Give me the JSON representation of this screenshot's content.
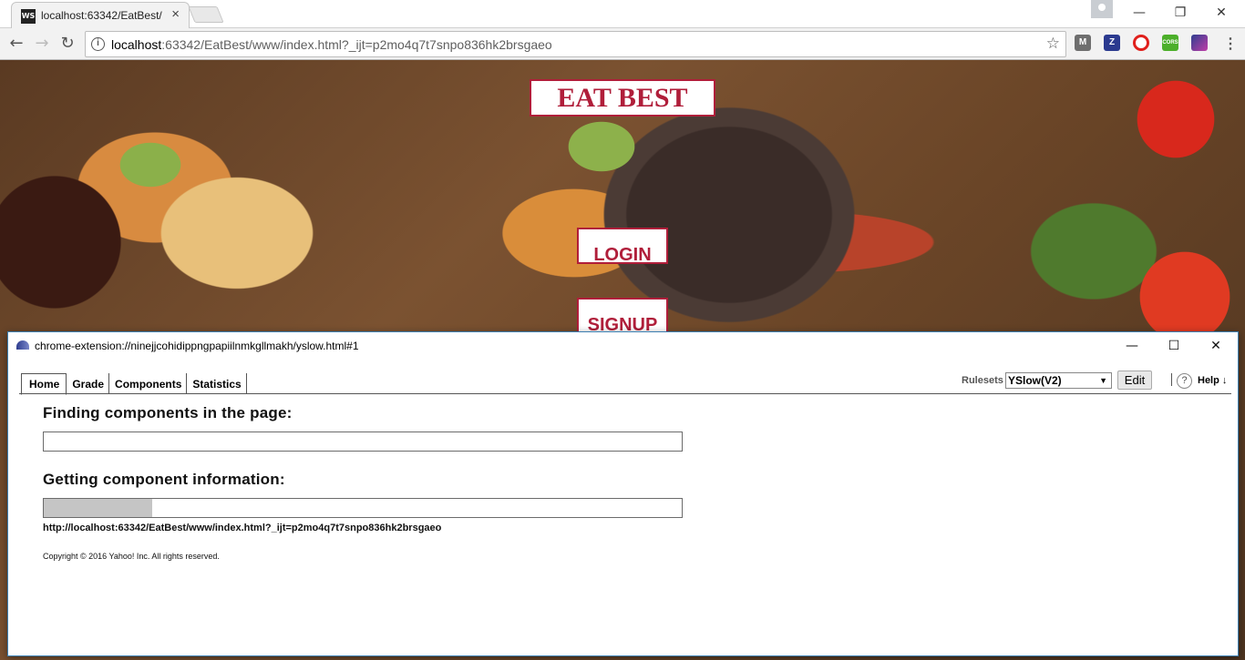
{
  "browser": {
    "tab_title": "localhost:63342/EatBest/",
    "tab_close": "×",
    "tab_favicon": "WS",
    "url_host": "localhost",
    "url_rest": ":63342/EatBest/www/index.html?_ijt=p2mo4q7t7snpo836hk2brsgaeo",
    "window_controls": {
      "minimize": "—",
      "restore": "❐",
      "close": "✕"
    },
    "nav": {
      "back": "←",
      "forward": "→",
      "reload": "↻"
    },
    "star": "☆",
    "extensions": [
      {
        "name": "m-extension-icon",
        "label": "M",
        "color": "#6e6e6e"
      },
      {
        "name": "z-extension-icon",
        "label": "Z",
        "color": "#2b3a8f"
      },
      {
        "name": "opera-extension-icon",
        "label": "O",
        "color": "#e0201c"
      },
      {
        "name": "cors-extension-icon",
        "label": "CORS",
        "color": "#4caf2a"
      },
      {
        "name": "yslow-extension-icon",
        "label": "",
        "color": "#2f3e8f"
      }
    ],
    "menu": "⋮"
  },
  "page": {
    "brand": "EAT BEST",
    "login": "LOGIN",
    "signup": "SIGNUP"
  },
  "popup": {
    "url": "chrome-extension://ninejjcohidippngpapiilnmkgllmakh/yslow.html#1",
    "controls": {
      "minimize": "—",
      "maximize": "☐",
      "close": "✕"
    },
    "tabs": [
      "Home",
      "Grade",
      "Components",
      "Statistics"
    ],
    "active_tab": "Home",
    "rulesets_label": "Rulesets",
    "rulesets_value": "YSlow(V2)",
    "rulesets_arrow": "▼",
    "edit_label": "Edit",
    "help_icon": "?",
    "help_label": "Help ↓",
    "finding_heading": "Finding components in the page:",
    "finding_progress": 0,
    "getting_heading": "Getting component information:",
    "getting_progress": 0.17,
    "progress_url": "http://localhost:63342/EatBest/www/index.html?_ijt=p2mo4q7t7snpo836hk2brsgaeo",
    "copyright": "Copyright © 2016 Yahoo! Inc. All rights reserved."
  }
}
